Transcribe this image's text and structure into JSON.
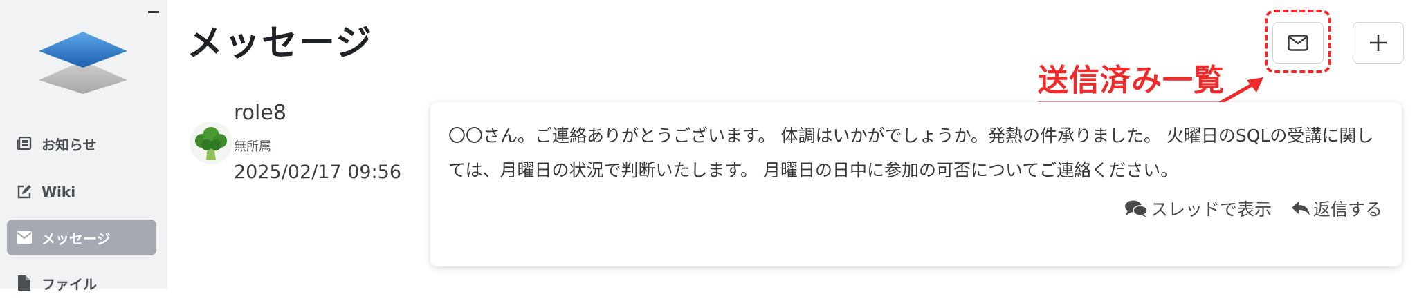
{
  "sidebar": {
    "items": [
      {
        "label": "お知らせ",
        "icon": "newspaper-icon"
      },
      {
        "label": "Wiki",
        "icon": "edit-icon"
      },
      {
        "label": "メッセージ",
        "icon": "envelope-icon",
        "active": true
      },
      {
        "label": "ファイル",
        "icon": "file-icon"
      }
    ]
  },
  "header": {
    "title": "メッセージ"
  },
  "annotation": {
    "label": "送信済み一覧",
    "color": "#ee2a2a"
  },
  "message": {
    "sender": "role8",
    "org": "無所属",
    "datetime": "2025/02/17 09:56",
    "body": "〇〇さん。ご連絡ありがとうございます。 体調はいかがでしょうか。発熱の件承りました。 火曜日のSQLの受講に関しては、月曜日の状況で判断いたします。 月曜日の日中に参加の可否についてご連絡ください。",
    "actions": {
      "thread": "スレッドで表示",
      "reply": "返信する"
    }
  },
  "colors": {
    "sidebar_bg": "#f1f2f4",
    "active_nav": "#a4a9b2",
    "title": "#1f2328"
  }
}
